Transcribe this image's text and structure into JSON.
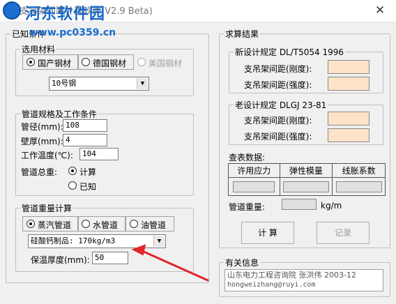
{
  "window": {
    "title": "支吊架间距计算软件(V2.9 Beta)",
    "watermark_title": "河东软件园",
    "watermark_url": "www.pc0359.cn",
    "close_label": "✕"
  },
  "known_conditions": {
    "group_label": "已知条件",
    "material": {
      "group_label": "选用材料",
      "options": [
        "国产钢材",
        "德国钢材",
        "美国钢材"
      ],
      "selected": "国产钢材",
      "steel_select": "10号钢"
    },
    "pipe_spec": {
      "group_label": "管道规格及工作条件",
      "diameter_label": "管径(mm):",
      "diameter_value": "108",
      "thickness_label": "壁厚(mm):",
      "thickness_value": "4",
      "temp_label": "工作温度(℃):",
      "temp_value": "104",
      "total_weight_label": "管道总重:",
      "calc_label": "计算",
      "known_label": "已知"
    },
    "pipe_weight": {
      "group_label": "管道重量计算",
      "options": [
        "蒸汽管道",
        "水管道",
        "油管道"
      ],
      "selected": "蒸汽管道",
      "insulation_select": "硅酸钙制品:      170kg/m3",
      "insulation_thickness_label": "保温厚度(mm):",
      "insulation_thickness_value": "50"
    }
  },
  "results": {
    "group_label": "求算结果",
    "new_spec": {
      "group_label": "新设计规定  DL/T5054 1996",
      "rigidity_label": "支吊架间距(刚度):",
      "strength_label": "支吊架间距(强度):"
    },
    "old_spec": {
      "group_label": "老设计规定  DLGJ 23-81",
      "rigidity_label": "支吊架间距(刚度):",
      "strength_label": "支吊架间距(强度):"
    },
    "lookup_label": "查表数据:",
    "lookup_headers": [
      "许用应力",
      "弹性模量",
      "线胀系数"
    ],
    "pipe_weight_label": "管道重量:",
    "pipe_weight_unit": "kg/m",
    "calc_button": "计 算",
    "record_button": "记录"
  },
  "info": {
    "group_label": "有关信息",
    "line1": "山东电力工程咨询院 张洪伟  2003-12",
    "line2": "hongweizhang@ruyi.com"
  },
  "colors": {
    "result_box": "#fde3c8",
    "watermark": "#1668c8",
    "annotation_arrow": "#e0262a"
  }
}
